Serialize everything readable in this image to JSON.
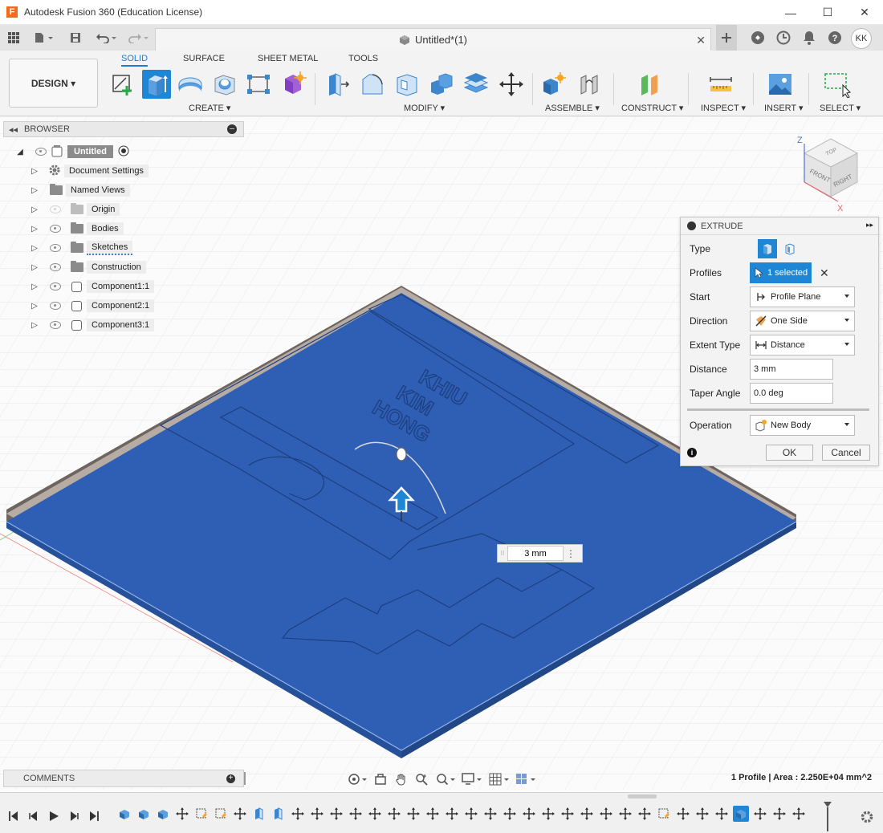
{
  "app": {
    "title": "Autodesk Fusion 360 (Education License)",
    "logo_letter": "F",
    "window_controls": [
      "—",
      "☐",
      "✕"
    ]
  },
  "document_tab": {
    "title": "Untitled*(1)",
    "user_initials": "KK"
  },
  "toolbar": {
    "workspace_button": "DESIGN ▾",
    "tabs": [
      "SOLID",
      "SURFACE",
      "SHEET METAL",
      "TOOLS"
    ],
    "active_tab": "SOLID",
    "groups": [
      "CREATE ▾",
      "MODIFY ▾",
      "ASSEMBLE ▾",
      "CONSTRUCT ▾",
      "INSPECT ▾",
      "INSERT ▾",
      "SELECT ▾"
    ]
  },
  "browser": {
    "title": "BROWSER",
    "root": "Untitled",
    "items": [
      {
        "label": "Document Settings",
        "icon": "gear-icon"
      },
      {
        "label": "Named Views",
        "icon": "folder-icon"
      },
      {
        "label": "Origin",
        "icon": "folder-icon"
      },
      {
        "label": "Bodies",
        "icon": "folder-icon"
      },
      {
        "label": "Sketches",
        "icon": "folder-icon"
      },
      {
        "label": "Construction",
        "icon": "folder-icon"
      },
      {
        "label": "Component1:1",
        "icon": "component-icon"
      },
      {
        "label": "Component2:1",
        "icon": "component-icon"
      },
      {
        "label": "Component3:1",
        "icon": "component-icon"
      }
    ]
  },
  "viewcube": {
    "top": "TOP",
    "front": "FRONT",
    "right": "RIGHT",
    "axis_z": "Z",
    "axis_x": "X"
  },
  "model": {
    "engraved_text": [
      "KHIU",
      "KIM",
      "HONG"
    ],
    "manipulator_value": "3 mm"
  },
  "extrude": {
    "title": "EXTRUDE",
    "rows": {
      "type": "Type",
      "profiles": "Profiles",
      "start": "Start",
      "direction": "Direction",
      "extent_type": "Extent Type",
      "distance": "Distance",
      "taper_angle": "Taper Angle",
      "operation": "Operation"
    },
    "profiles_value": "1 selected",
    "start_value": "Profile Plane",
    "direction_value": "One Side",
    "extent_value": "Distance",
    "distance_value": "3 mm",
    "taper_value": "0.0 deg",
    "operation_value": "New Body",
    "ok": "OK",
    "cancel": "Cancel"
  },
  "comments": {
    "title": "COMMENTS"
  },
  "status": {
    "text": "1 Profile | Area : 2.250E+04 mm^2"
  },
  "colors": {
    "accent": "#1f86d6",
    "model_blue": "#2f5fb5",
    "logo_orange": "#f26b21"
  }
}
